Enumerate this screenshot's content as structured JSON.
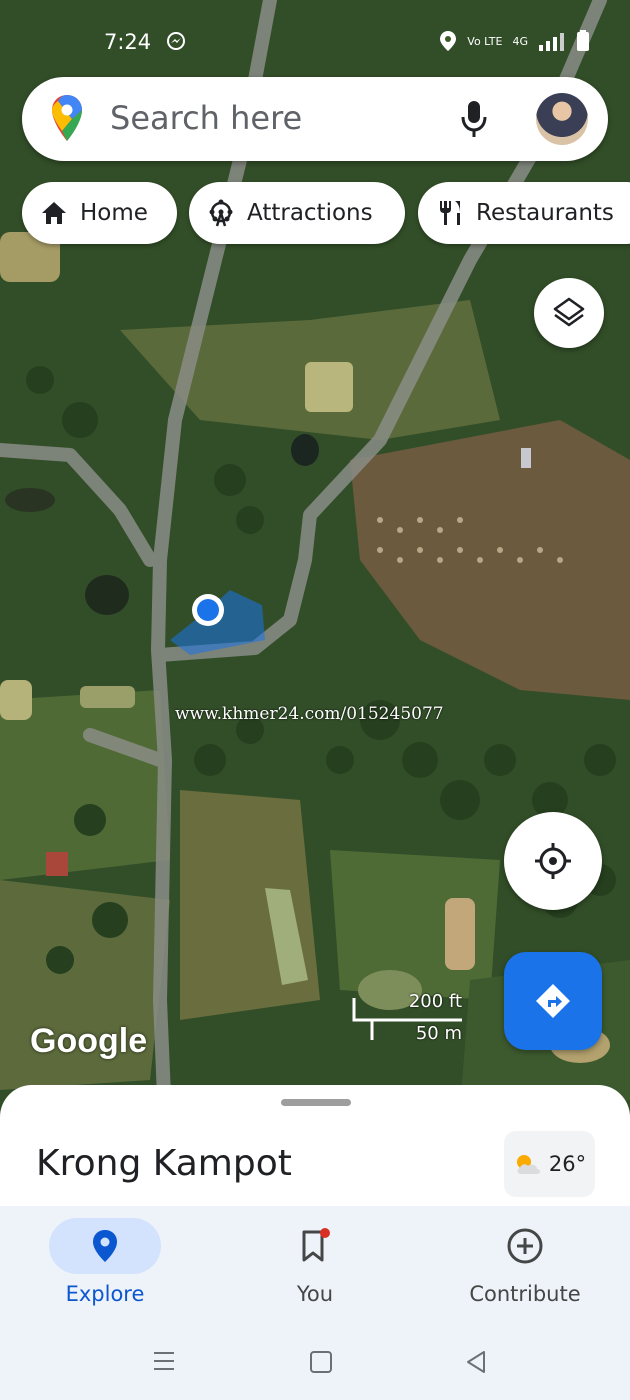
{
  "status_bar": {
    "time": "7:24",
    "network": "4G",
    "volte": "Vo LTE"
  },
  "search": {
    "placeholder": "Search here"
  },
  "chips": [
    {
      "label": "Home",
      "icon": "home-icon"
    },
    {
      "label": "Attractions",
      "icon": "ferris-wheel-icon"
    },
    {
      "label": "Restaurants",
      "icon": "fork-knife-icon"
    }
  ],
  "map": {
    "watermark": "www.khmer24.com/015245077",
    "logo": "Google",
    "scale_ft": "200 ft",
    "scale_m": "50 m"
  },
  "sheet": {
    "place": "Krong Kampot",
    "temperature": "26°"
  },
  "bottom_nav": {
    "explore": "Explore",
    "you": "You",
    "contribute": "Contribute"
  },
  "colors": {
    "accent": "#1a73e8",
    "nav_bg": "#eef2f9",
    "explore_active": "#d3e3fd"
  }
}
